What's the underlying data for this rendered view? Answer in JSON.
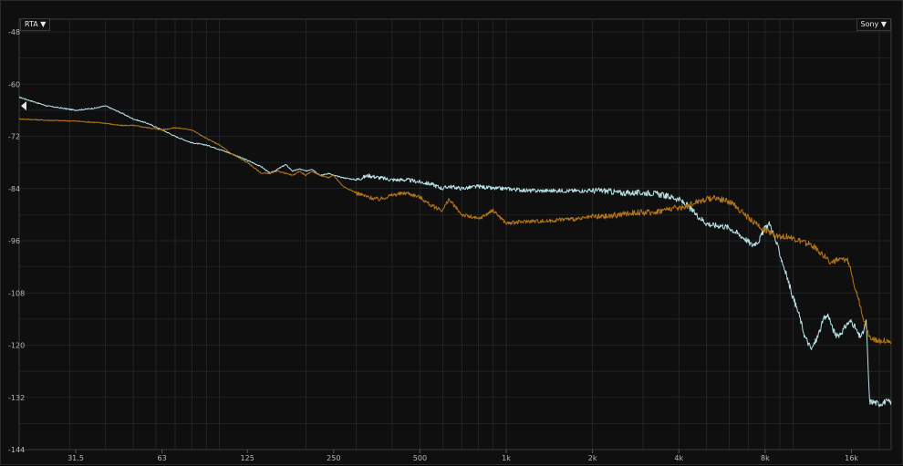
{
  "controls": {
    "mode_label": "RTA ▼",
    "source_label": "Sony ▼"
  },
  "colors": {
    "background": "#0f0f10",
    "grid": "#2e3235",
    "series_a": "#b8e4e8",
    "series_b": "#b87716",
    "marker": "#e6e6e6"
  },
  "chart_data": {
    "type": "line",
    "title": "",
    "xlabel": "",
    "ylabel": "",
    "x_scale": "log",
    "xlim": [
      20,
      22000
    ],
    "ylim": [
      -144,
      -48
    ],
    "grid": true,
    "y_ticks": [
      -48,
      -60,
      -72,
      -84,
      -96,
      -108,
      -120,
      -132,
      -144
    ],
    "x_ticks": [
      {
        "value": 31.5,
        "label": "31.5"
      },
      {
        "value": 63,
        "label": "63"
      },
      {
        "value": 125,
        "label": "125"
      },
      {
        "value": 250,
        "label": "250"
      },
      {
        "value": 500,
        "label": "500"
      },
      {
        "value": 1000,
        "label": "1k"
      },
      {
        "value": 2000,
        "label": "2k"
      },
      {
        "value": 4000,
        "label": "4k"
      },
      {
        "value": 8000,
        "label": "8k"
      },
      {
        "value": 16000,
        "label": "16k"
      }
    ],
    "marker_level": -65,
    "series": [
      {
        "color": "#b8e4e8",
        "x": [
          20,
          25,
          31.5,
          37,
          40,
          45,
          50,
          56,
          63,
          70,
          80,
          90,
          100,
          110,
          125,
          140,
          150,
          160,
          170,
          180,
          190,
          200,
          210,
          225,
          240,
          250,
          270,
          300,
          330,
          360,
          400,
          450,
          500,
          550,
          600,
          630,
          700,
          800,
          900,
          1000,
          1200,
          1400,
          1600,
          1800,
          2000,
          2200,
          2500,
          2800,
          3200,
          3500,
          3800,
          4000,
          4300,
          4600,
          5000,
          5300,
          5600,
          6000,
          6300,
          6800,
          7200,
          7600,
          8000,
          8300,
          8600,
          9000,
          9500,
          10000,
          10500,
          11000,
          11600,
          12200,
          12800,
          13300,
          13700,
          14200,
          14800,
          15500,
          16000,
          16500,
          17000,
          17500,
          18000,
          18500,
          19000,
          20000,
          21000,
          22000
        ],
        "values": [
          -63,
          -65,
          -66,
          -65.5,
          -65,
          -66.5,
          -68,
          -69,
          -70.5,
          -72,
          -73.5,
          -74,
          -75,
          -76,
          -77.5,
          -79,
          -80.5,
          -79.5,
          -78.5,
          -80,
          -79.5,
          -80,
          -79.5,
          -81,
          -80.5,
          -81,
          -81.5,
          -82,
          -81,
          -81.5,
          -82,
          -82,
          -82.5,
          -83,
          -84,
          -83.5,
          -84,
          -83.5,
          -84,
          -84,
          -84.5,
          -84.5,
          -84.5,
          -84.5,
          -84.5,
          -84.5,
          -85,
          -85,
          -85,
          -85.5,
          -86,
          -86.5,
          -88,
          -90,
          -92,
          -92.5,
          -92.5,
          -93,
          -94,
          -95.5,
          -97,
          -96,
          -93,
          -92,
          -95,
          -99,
          -104,
          -109,
          -113,
          -118,
          -121,
          -118,
          -114,
          -113,
          -116,
          -118,
          -117,
          -115,
          -114.5,
          -116,
          -118,
          -117.5,
          -114.5,
          -133,
          -133,
          -133.5,
          -133,
          -133
        ]
      },
      {
        "color": "#b87716",
        "x": [
          20,
          25,
          31.5,
          37,
          40,
          45,
          50,
          56,
          63,
          70,
          80,
          90,
          100,
          110,
          125,
          140,
          150,
          160,
          170,
          180,
          190,
          200,
          210,
          225,
          240,
          250,
          270,
          300,
          330,
          360,
          400,
          450,
          500,
          550,
          600,
          630,
          700,
          800,
          900,
          1000,
          1200,
          1400,
          1600,
          1800,
          2000,
          2200,
          2500,
          2800,
          3200,
          3500,
          3800,
          4000,
          4300,
          4600,
          5000,
          5300,
          5600,
          6000,
          6300,
          6800,
          7200,
          7600,
          8000,
          8300,
          8600,
          9000,
          9500,
          10000,
          10500,
          11000,
          11600,
          12200,
          12800,
          13300,
          13700,
          14200,
          14800,
          15500,
          16000,
          16500,
          17000,
          17500,
          18000,
          18500,
          19000,
          20000,
          21000,
          22000
        ],
        "values": [
          -68,
          -68.3,
          -68.5,
          -68.8,
          -69,
          -69.5,
          -69.5,
          -70,
          -70.5,
          -70,
          -70.5,
          -72.5,
          -74,
          -76,
          -78,
          -80.5,
          -80.5,
          -80,
          -80.5,
          -81,
          -80,
          -81,
          -80,
          -81,
          -81.5,
          -81,
          -83.5,
          -85,
          -86,
          -86.5,
          -85.5,
          -85,
          -86,
          -88,
          -89,
          -86.5,
          -90,
          -91,
          -89,
          -92,
          -91.5,
          -91.5,
          -91,
          -91,
          -90.5,
          -90.5,
          -90,
          -89.5,
          -89.5,
          -89,
          -88.5,
          -88.5,
          -88,
          -87,
          -86.5,
          -86,
          -86.5,
          -87,
          -88,
          -90,
          -91.5,
          -92.5,
          -93.5,
          -94,
          -94.5,
          -95,
          -95,
          -95.5,
          -96,
          -96.5,
          -97,
          -98,
          -99.5,
          -100.5,
          -101,
          -100.5,
          -100.5,
          -100.5,
          -103,
          -107,
          -110,
          -113,
          -116,
          -118,
          -118.5,
          -119,
          -119,
          -119.5
        ]
      }
    ]
  }
}
